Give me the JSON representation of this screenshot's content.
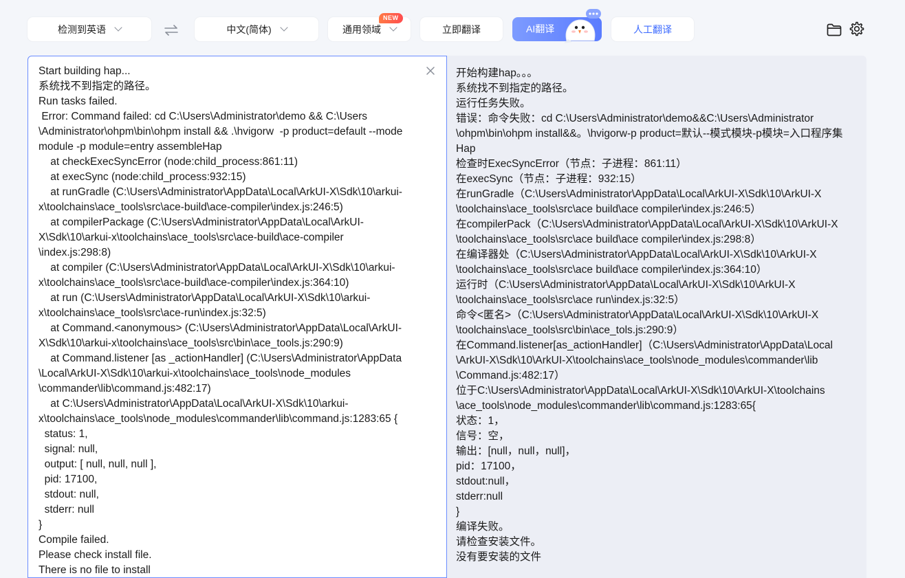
{
  "toolbar": {
    "source_lang": "检测到英语",
    "target_lang": "中文(简体)",
    "domain": "通用领域",
    "new_badge": "NEW",
    "translate_now": "立即翻译",
    "ai_translate": "AI翻译",
    "human_translate": "人工翻译",
    "icons": [
      "swap-icon",
      "chevron-down-icon",
      "folder-icon",
      "gear-icon",
      "close-icon"
    ]
  },
  "colors": {
    "accent": "#5a7cff",
    "focus_border": "#6a8cff",
    "new_badge": "#ff5a4a",
    "right_panel_bg": "#eceef5"
  },
  "source": {
    "lines": [
      "Start building hap...",
      "系统找不到指定的路径。",
      "Run tasks failed.",
      " Error: Command failed: cd C:\\Users\\Administrator\\demo && C:\\Users",
      "\\Administrator\\ohpm\\bin\\ohpm install && .\\hvigorw  -p product=default --mode",
      "module -p module=entry assembleHap",
      "    at checkExecSyncError (node:child_process:861:11)",
      "    at execSync (node:child_process:932:15)",
      "    at runGradle (C:\\Users\\Administrator\\AppData\\Local\\ArkUI-X\\Sdk\\10\\arkui-",
      "x\\toolchains\\ace_tools\\src\\ace-build\\ace-compiler\\index.js:246:5)",
      "    at compilerPackage (C:\\Users\\Administrator\\AppData\\Local\\ArkUI-",
      "X\\Sdk\\10\\arkui-x\\toolchains\\ace_tools\\src\\ace-build\\ace-compiler",
      "\\index.js:298:8)",
      "    at compiler (C:\\Users\\Administrator\\AppData\\Local\\ArkUI-X\\Sdk\\10\\arkui-",
      "x\\toolchains\\ace_tools\\src\\ace-build\\ace-compiler\\index.js:364:10)",
      "    at run (C:\\Users\\Administrator\\AppData\\Local\\ArkUI-X\\Sdk\\10\\arkui-",
      "x\\toolchains\\ace_tools\\src\\ace-run\\index.js:32:5)",
      "    at Command.<anonymous> (C:\\Users\\Administrator\\AppData\\Local\\ArkUI-",
      "X\\Sdk\\10\\arkui-x\\toolchains\\ace_tools\\src\\bin\\ace_tools.js:290:9)",
      "    at Command.listener [as _actionHandler] (C:\\Users\\Administrator\\AppData",
      "\\Local\\ArkUI-X\\Sdk\\10\\arkui-x\\toolchains\\ace_tools\\node_modules",
      "\\commander\\lib\\command.js:482:17)",
      "    at C:\\Users\\Administrator\\AppData\\Local\\ArkUI-X\\Sdk\\10\\arkui-",
      "x\\toolchains\\ace_tools\\node_modules\\commander\\lib\\command.js:1283:65 {",
      "  status: 1,",
      "  signal: null,",
      "  output: [ null, null, null ],",
      "  pid: 17100,",
      "  stdout: null,",
      "  stderr: null",
      "}",
      "Compile failed.",
      "Please check install file.",
      "There is no file to install"
    ]
  },
  "target": {
    "lines": [
      "开始构建hap。。。",
      "系统找不到指定的路径。",
      "运行任务失败。",
      "错误：命令失败：cd C:\\Users\\Administrator\\demo&&C:\\Users\\Administrator",
      "\\ohpm\\bin\\ohpm install&&。\\hvigorw-p product=默认--模式模块-p模块=入口程序集",
      "Hap",
      "检查时ExecSyncError（节点：子进程：861:11）",
      "在execSync（节点：子进程：932:15）",
      "在runGradle（C:\\Users\\Administrator\\AppData\\Local\\ArkUI-X\\Sdk\\10\\ArkUI-X",
      "\\toolchains\\ace_tools\\src\\ace build\\ace compiler\\index.js:246:5）",
      "在compilerPack（C:\\Users\\Administrator\\AppData\\Local\\ArkUI-X\\Sdk\\10\\ArkUI-X",
      "\\toolchains\\ace_tools\\src\\ace build\\ace compiler\\index.js:298:8）",
      "在编译器处（C:\\Users\\Administrator\\AppData\\Local\\ArkUI-X\\Sdk\\10\\ArkUI-X",
      "\\toolchains\\ace_tools\\src\\ace build\\ace compiler\\index.js:364:10）",
      "运行时（C:\\Users\\Administrator\\AppData\\Local\\ArkUI-X\\Sdk\\10\\ArkUI-X",
      "\\toolchains\\ace_tools\\src\\ace run\\index.js:32:5）",
      "命令<匿名>（C:\\Users\\Administrator\\AppData\\Local\\ArkUI-X\\Sdk\\10\\ArkUI-X",
      "\\toolchains\\ace_tools\\src\\bin\\ace_tols.js:290:9）",
      "在Command.listener[as_actionHandler]（C:\\Users\\Administrator\\AppData\\Local",
      "\\ArkUI-X\\Sdk\\10\\ArkUI-X\\toolchains\\ace_tools\\node_modules\\commander\\lib",
      "\\Command.js:482:17）",
      "位于C:\\Users\\Administrator\\AppData\\Local\\ArkUI-X\\Sdk\\10\\ArkUI-X\\toolchains",
      "\\ace_tools\\node_modules\\commander\\lib\\command.js:1283:65{",
      "状态：1，",
      "信号：空，",
      "输出：[null，null，null]，",
      "pid：17100，",
      "stdout:null，",
      "stderr:null",
      "}",
      "编译失败。",
      "请检查安装文件。",
      "没有要安装的文件"
    ]
  }
}
